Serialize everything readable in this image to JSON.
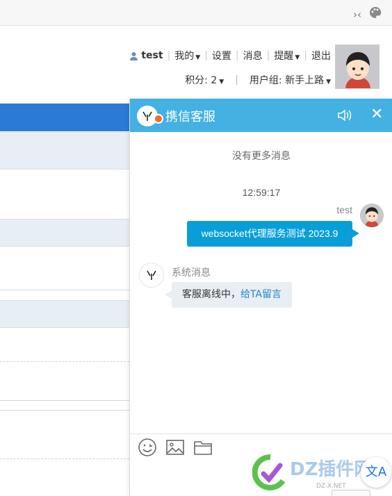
{
  "browser": {
    "icons": [
      "collapse-arrows-icon",
      "palette-icon"
    ]
  },
  "usernav": {
    "username": "test",
    "mine": "我的",
    "settings": "设置",
    "messages": "消息",
    "reminders": "提醒",
    "logout": "退出",
    "points_label": "积分: 2",
    "usergroup_label": "用户组: 新手上路"
  },
  "chat": {
    "title": "携信客服",
    "no_more": "没有更多消息",
    "time": "12:59:17",
    "sender": "test",
    "my_message": "websocket代理服务测试 2023.9",
    "system_name": "系统消息",
    "system_text": "客服离线中，",
    "system_link": "给TA留言",
    "toolbar_icons": [
      "emoji-icon",
      "image-icon",
      "folder-icon"
    ]
  },
  "colors": {
    "header": "#43b1e2",
    "bubble_me": "#099ed8",
    "page_blue": "#2b7bd6"
  },
  "watermark": {
    "brand": "DZ插件网",
    "domain": "DZ-X.NET"
  }
}
